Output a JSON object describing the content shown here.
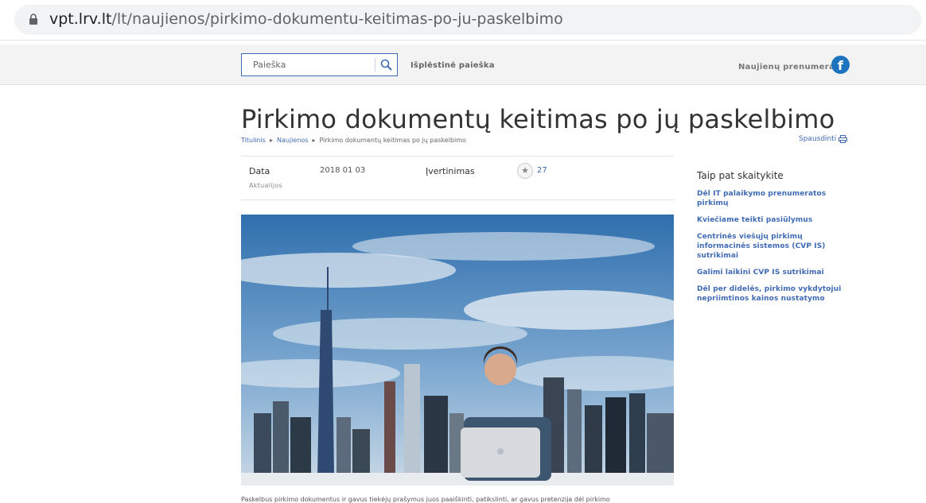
{
  "browser": {
    "url_host": "vpt.lrv.lt",
    "url_path": "/lt/naujienos/pirkimo-dokumentu-keitimas-po-ju-paskelbimo",
    "lock_icon": "lock-icon"
  },
  "header": {
    "search_placeholder": "Paieška",
    "advanced_search": "Išplėstinė paieška",
    "subscribe": "Naujienų prenumerata",
    "facebook_glyph": "f"
  },
  "article": {
    "title": "Pirkimo dokumentų keitimas po jų paskelbimo",
    "breadcrumbs": [
      "Titulinis",
      "Naujienos",
      "Pirkimo dokumentų keitimas po jų paskelbimo"
    ],
    "print_label": "Spausdinti",
    "date_label": "Data",
    "date_value": "2018 01 03",
    "category": "Aktualijos",
    "rating_label": "Įvertinimas",
    "rating_count": "27",
    "snippet": "Paskelbus pirkimo dokumentus ir gavus tiekėjų prašymus juos paaiškinti, patikslinti, ar gavus pretenzija dėl pirkimo"
  },
  "sidebar": {
    "title": "Taip pat skaitykite",
    "links": [
      "Dėl IT palaikymo prenumeratos pirkimų",
      "Kviečiame teikti pasiūlymus",
      "Centrinės viešųjų pirkimų informacinės sistemos (CVP IS) sutrikimai",
      "Galimi laikini CVP IS sutrikimai",
      "Dėl per didelės, pirkimo vykdytojui nepriimtinos kainos nustatymo"
    ]
  },
  "colors": {
    "link": "#3f6ab3",
    "facebook": "#1e73be"
  }
}
